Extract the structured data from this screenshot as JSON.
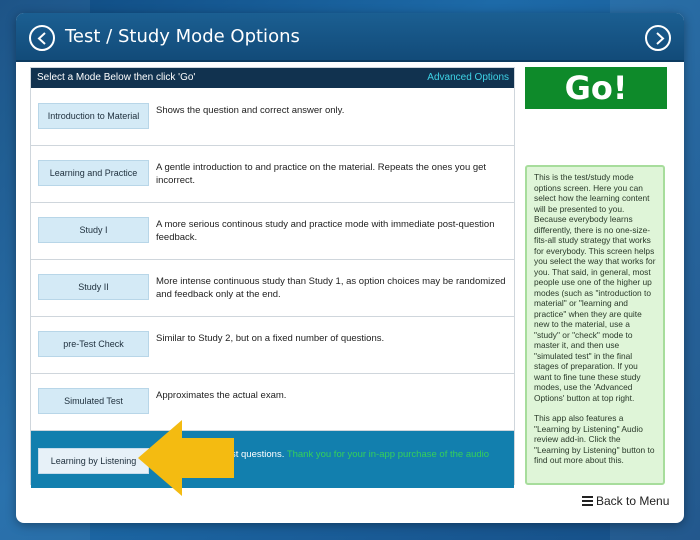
{
  "window": {
    "title": "Test / Study Mode Options"
  },
  "list": {
    "header": "Select a Mode Below then click 'Go'",
    "advanced_label": "Advanced Options",
    "modes": [
      {
        "label": "Introduction to Material",
        "description": "Shows the question and correct answer only."
      },
      {
        "label": "Learning and Practice",
        "description": "A gentle introduction to and practice on the material. Repeats the ones you get incorrect."
      },
      {
        "label": "Study I",
        "description": "A more serious continous study and practice mode with immediate post-question feedback."
      },
      {
        "label": "Study II",
        "description": "More intense continuous study than Study 1, as option choices may be randomized and feedback only at the end."
      },
      {
        "label": "pre-Test Check",
        "description": "Similar to Study 2, but on a fixed number of questions."
      },
      {
        "label": "Simulated Test",
        "description": "Approximates the actual exam."
      },
      {
        "label": "Learning by Listening",
        "description": "st questions.",
        "description_highlight": "Thank you for your in-app purchase of the audio"
      }
    ]
  },
  "go_label": "Go!",
  "help": {
    "paragraph1": "This is the test/study mode options screen. Here you can select how the learning content will be presented to you. Because everybody learns differently, there is no one-size-fits-all study strategy that works for everybody. This screen helps you select the way that works for you. That said, in general, most people use one of the higher up modes (such as \"introduction to material\" or \"learning and practice\" when they are quite new to the material, use a \"study\" or \"check\" mode to master it, and then use \"simulated test\" in the final stages of preparation. If you want to fine tune these study modes, use the 'Advanced Options' button at top right.",
    "paragraph2": "This app also features a \"Learning by Listening\" Audio review add-in. Click the \"Learning by Listening\" button to find out more about this."
  },
  "back_label": "Back to Menu",
  "colors": {
    "title_bar": "#124b79",
    "list_header": "#11324f",
    "advanced_link": "#3ed3e6",
    "go_button": "#0e8a2a",
    "help_background": "#dff5d8",
    "selected_row": "#127fae",
    "highlight_text": "#35d05a",
    "arrow": "#f4bb11"
  },
  "icons": {
    "back": "chevron-left-circle-icon",
    "forward": "chevron-right-circle-icon",
    "menu": "hamburger-menu-icon",
    "pointer": "arrow-left-icon"
  }
}
